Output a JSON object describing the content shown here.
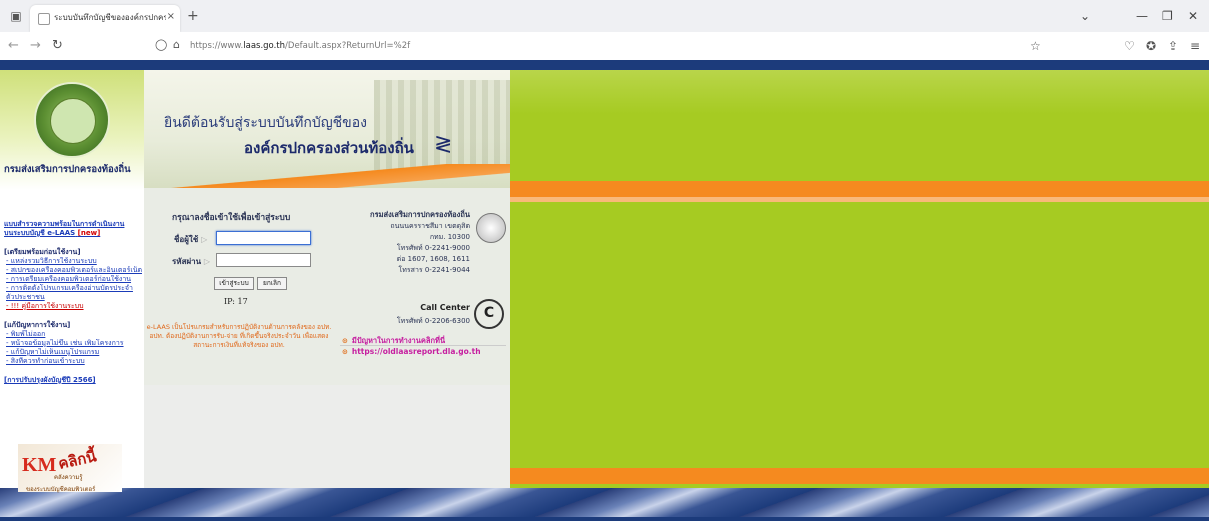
{
  "browser": {
    "tab_title": "ระบบบันทึกบัญชีขององค์กรปกครองส่วนท้องถิ่น",
    "tab_close": "×",
    "new_tab": "+",
    "url_prefix": "https://www.",
    "url_domain": "laas.go.th",
    "url_suffix": "/Default.aspx?ReturnUrl=%2f",
    "icons": {
      "tab_list": "tab-list-icon",
      "back": "back-arrow-icon",
      "forward": "forward-arrow-icon",
      "reload": "reload-icon",
      "shield": "shield-icon",
      "lock": "lock-icon",
      "bookmark": "star-icon",
      "pocket": "pocket-icon",
      "extensions": "extension-icon",
      "share": "share-icon",
      "menu": "hamburger-menu-icon",
      "minimize": "minimize-icon",
      "restore": "restore-icon",
      "close": "close-icon",
      "dropdown": "chevron-down-icon"
    }
  },
  "sidebar": {
    "dept_title": "กรมส่งเสริมการปกครองท้องถิ่น",
    "survey_line1": "แบบสำรวจความพร้อมในการดำเนินงาน",
    "survey_line2": "บนระบบบัญชี e-LAAS",
    "new_badge": "[new]",
    "section1_title": "[เตรียมพร้อมก่อนใช้งาน]",
    "section1_items": [
      "- แหล่งรวมวิธีการใช้งานระบบ",
      "- สเปกของเครื่องคอมพิวเตอร์และอินเตอร์เน็ต",
      "- การเตรียมเครื่องคอมพิวเตอร์ก่อนใช้งาน",
      "- การติดตั้งโปรแกรมเครื่องอ่านบัตรประจำ",
      "ตัวประชาชน",
      "- !!! คู่มือการใช้งานระบบ"
    ],
    "section2_title": "[แก้ปัญหาการใช้งาน]",
    "section2_items": [
      "- พิมพ์ไม่ออก",
      "- หน้าจอข้อมูลไม่ขึ้น เช่น เพิ่มโครงการ",
      "- แก้ปัญหาไม่เห็นเมนูโปรแกรม",
      "- สิ่งที่ควรทำก่อนเข้าระบบ"
    ],
    "update_link": "[การปรับปรุงผังบัญชีปี 2566]",
    "km_big": "KM",
    "km_word": "คลิกนี้",
    "km_sub": "คลังความรู้",
    "km_caption": "ของระบบบัญชีคอมพิวเตอร์"
  },
  "banner": {
    "line1": "ยินดีต้อนรับสู่ระบบบันทึกบัญชีของ",
    "line2": "องค์กรปกครองส่วนท้องถิ่น"
  },
  "login": {
    "title": "กรุณาลงชื่อเข้าใช้เพื่อเข้าสู่ระบบ",
    "username_label": "ชื่อผู้ใช้",
    "password_label": "รหัสผ่าน",
    "arrow": "▷",
    "username_value": "",
    "password_value": "",
    "login_button": "เข้าสู่ระบบ",
    "cancel_button": "ยกเลิก",
    "ip_text": "IP: 17",
    "notice": "e-LAAS เป็นโปรแกรมสำหรับการปฏิบัติงานด้านการคลังของ อปท. อปท. ต้องปฏิบัติงานการรับ-จ่าย ที่เกิดขึ้นจริงประจำวัน เพื่อแสดงสถานะการเงินที่แท้จริงของ อปท."
  },
  "contact": {
    "title": "กรมส่งเสริมการปกครองท้องถิ่น",
    "address1": "ถนนนครราชสีมา เขตดุสิต",
    "address2": "กทม. 10300",
    "phone": "โทรศัพท์ 0-2241-9000",
    "ext": "ต่อ 1607, 1608, 1611",
    "fax": "โทรสาร 0-2241-9044",
    "call_center_title": "Call Center",
    "call_center_phone": "โทรศัพท์ 0-2206-6300",
    "call_center_icon": "C",
    "problem_text": "มีปัญหาในการทำงานคลิกที่นี่",
    "old_report_link": "https://oldlaasreport.dla.go.th",
    "bullet": "⊙"
  },
  "colors": {
    "accent_green": "#a6cb22",
    "accent_orange": "#f58a1f",
    "navy": "#1c3b7b",
    "link_blue": "#1a3bb8",
    "magenta_link": "#c61fa0"
  }
}
